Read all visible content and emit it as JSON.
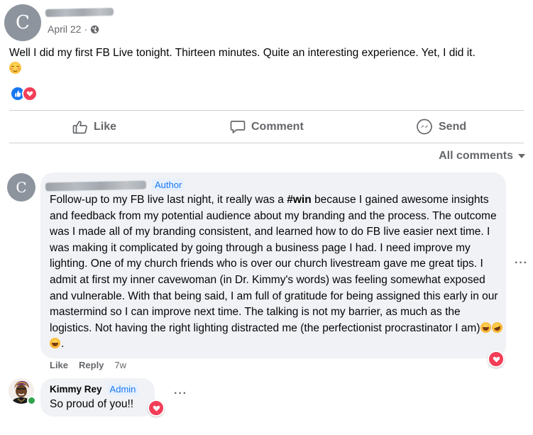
{
  "post": {
    "author_initial": "C",
    "date": "April 22",
    "separator": "·",
    "audience_icon": "globe-icon",
    "text": "Well I did my first FB Live tonight. Thirteen minutes. Quite an interesting experience. Yet, I did it.",
    "reactions": [
      "like-reaction-icon",
      "love-reaction-icon"
    ]
  },
  "actions": {
    "like": "Like",
    "comment": "Comment",
    "send": "Send"
  },
  "comments_filter": {
    "label": "All comments"
  },
  "comment": {
    "author_initial": "C",
    "badge": "Author",
    "text_before_bold": "Follow-up to my FB live last night, it really was a ",
    "bold": "#win",
    "text_after_bold": " because I gained awesome insights and feedback from my potential audience about my branding and the process. The outcome was I made all of my branding consistent, and learned how to do FB live easier next time. I was making it complicated by going through a business page I had. I need improve my lighting. One of my church friends who is over our church livestream gave me great tips. I admit at first my inner cavewoman (in Dr. Kimmy's words) was feeling somewhat exposed and vulnerable. With that being said, I am full of gratitude for being assigned this early in our mastermind so I can improve next time. The talking is not my barrier, as much as the logistics. Not having the right lighting distracted me (the perfectionist procrastinator I am)",
    "text_end": ".",
    "like_label": "Like",
    "reply_label": "Reply",
    "age": "7w",
    "more": "···"
  },
  "reply": {
    "author": "Kimmy Rey",
    "badge": "Admin",
    "text": "So proud of you!!",
    "more": "···"
  },
  "colors": {
    "accent": "#1877f2",
    "love": "#f33e58",
    "muted": "#65676b",
    "bubble": "#f0f2f5",
    "online": "#31a24c"
  }
}
